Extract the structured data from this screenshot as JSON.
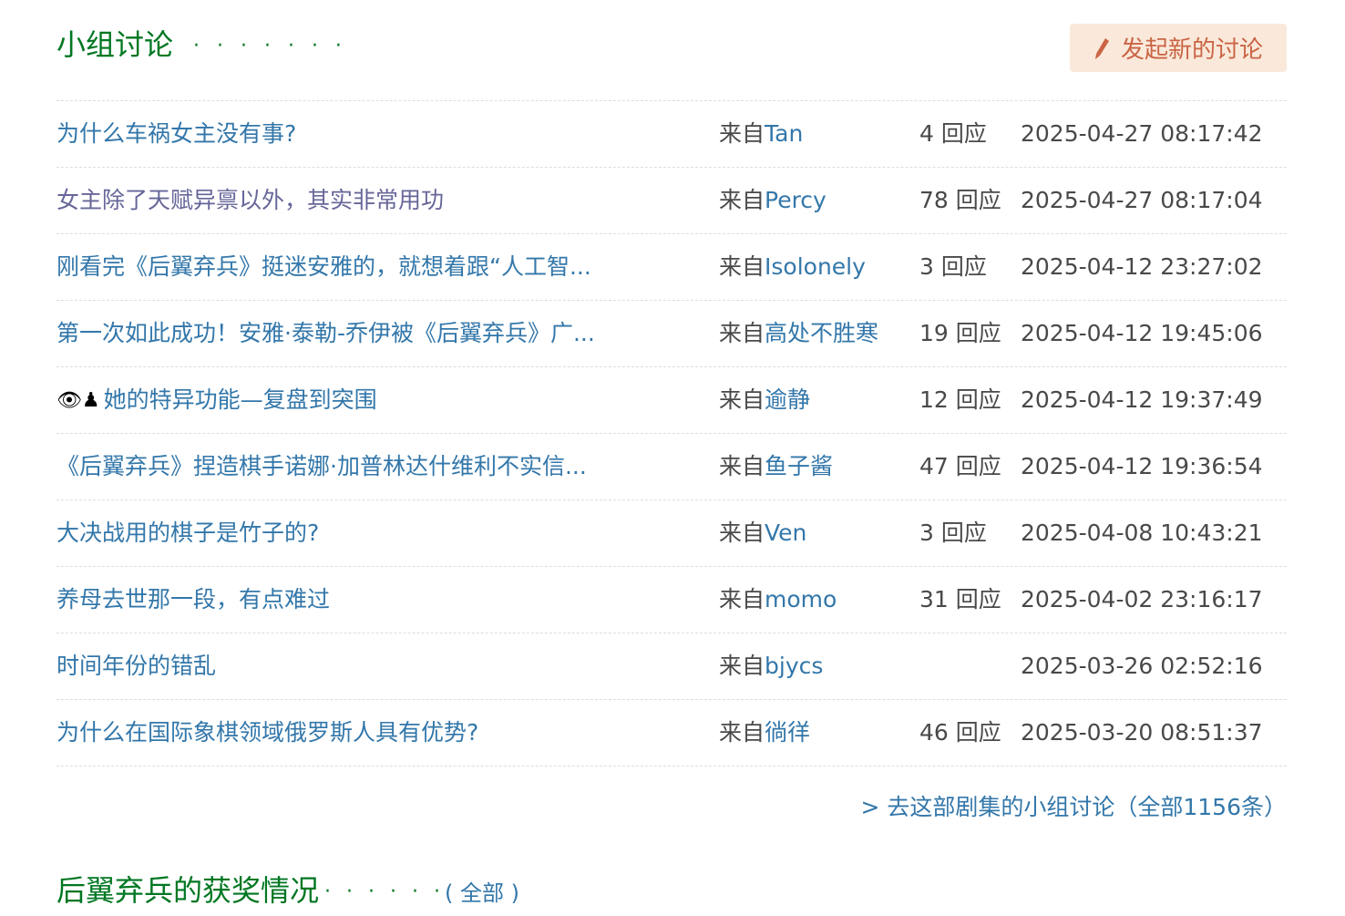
{
  "section": {
    "title": "小组讨论",
    "dots": "· · · · · · ·"
  },
  "new_button": {
    "label": "发起新的讨论"
  },
  "topics": [
    {
      "title": "为什么车祸女主没有事?",
      "from_prefix": "来自",
      "author": "Tan",
      "replies": "4 回应",
      "time": "2025-04-27 08:17:42"
    },
    {
      "title": "女主除了天赋异禀以外，其实非常用功",
      "from_prefix": "来自",
      "author": "Percy",
      "replies": "78 回应",
      "time": "2025-04-27 08:17:04"
    },
    {
      "title": "刚看完《后翼弃兵》挺迷安雅的，就想着跟“人工智...",
      "from_prefix": "来自",
      "author": "Isolonely",
      "replies": "3 回应",
      "time": "2025-04-12 23:27:02"
    },
    {
      "title": "第一次如此成功！安雅·泰勒-乔伊被《后翼弃兵》广...",
      "from_prefix": "来自",
      "author": "高处不胜寒",
      "replies": "19 回应",
      "time": "2025-04-12 19:45:06"
    },
    {
      "title_emoji": "👁♟",
      "title": "她的特异功能—复盘到突围",
      "from_prefix": "来自",
      "author": "逾静",
      "replies": "12 回应",
      "time": "2025-04-12 19:37:49"
    },
    {
      "title": "《后翼弃兵》捏造棋手诺娜·加普林达什维利不实信...",
      "from_prefix": "来自",
      "author": "鱼子酱",
      "replies": "47 回应",
      "time": "2025-04-12 19:36:54"
    },
    {
      "title": "大决战用的棋子是竹子的?",
      "from_prefix": "来自",
      "author": "Ven",
      "replies": "3 回应",
      "time": "2025-04-08 10:43:21"
    },
    {
      "title": "养母去世那一段，有点难过",
      "from_prefix": "来自",
      "author": "momo",
      "replies": "31 回应",
      "time": "2025-04-02 23:16:17"
    },
    {
      "title": "时间年份的错乱",
      "from_prefix": "来自",
      "author": "bjycs",
      "replies": "",
      "time": "2025-03-26 02:52:16"
    },
    {
      "title": "为什么在国际象棋领域俄罗斯人具有优势?",
      "from_prefix": "来自",
      "author": "徜徉",
      "replies": "46 回应",
      "time": "2025-03-20 08:51:37"
    }
  ],
  "more_link": {
    "label": "> 去这部剧集的小组讨论（全部1156条）"
  },
  "awards": {
    "title": "后翼弃兵的获奖情况",
    "dots": "· · · · · ·",
    "open": "(",
    "all_label": "全部",
    "close": ")"
  },
  "colors": {
    "title_green": "#007722",
    "link_blue": "#3377aa",
    "visited_purple": "#666699",
    "button_bg": "#fae9da",
    "button_text": "#ca6445",
    "text_gray": "#494949"
  },
  "icons": {
    "new_button": "pencil-icon"
  }
}
